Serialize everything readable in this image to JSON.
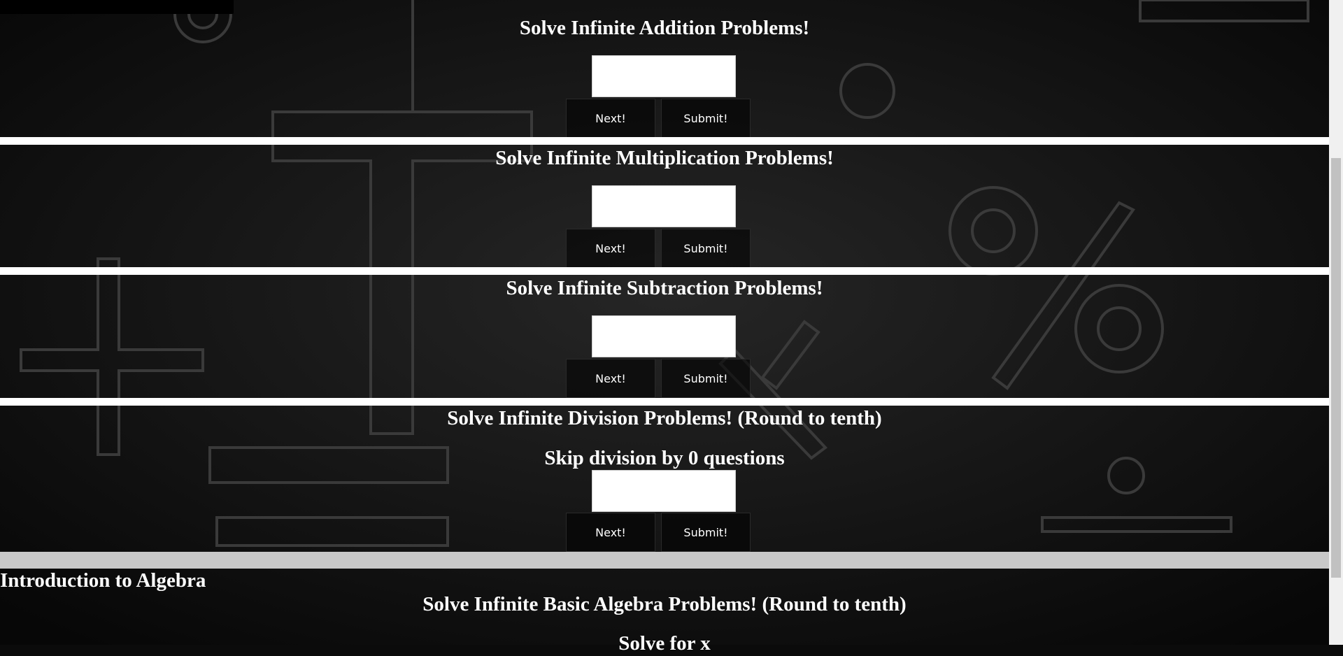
{
  "sections": [
    {
      "title": "Solve Infinite Addition Problems!",
      "next_label": "Next!",
      "submit_label": "Submit!"
    },
    {
      "title": "Solve Infinite Multiplication Problems!",
      "next_label": "Next!",
      "submit_label": "Submit!"
    },
    {
      "title": "Solve Infinite Subtraction Problems!",
      "next_label": "Next!",
      "submit_label": "Submit!"
    },
    {
      "title": "Solve Infinite Division Problems! (Round to tenth)",
      "subtitle": "Skip division by 0 questions",
      "next_label": "Next!",
      "submit_label": "Submit!"
    }
  ],
  "algebra": {
    "heading": "Introduction to Algebra",
    "title": "Solve Infinite Basic Algebra Problems! (Round to tenth)",
    "subtitle": "Solve for x"
  },
  "colors": {
    "background": "#0b0b0b",
    "text": "#ffffff",
    "divider": "#ffffff",
    "gray_divider": "#c8c8c8"
  }
}
